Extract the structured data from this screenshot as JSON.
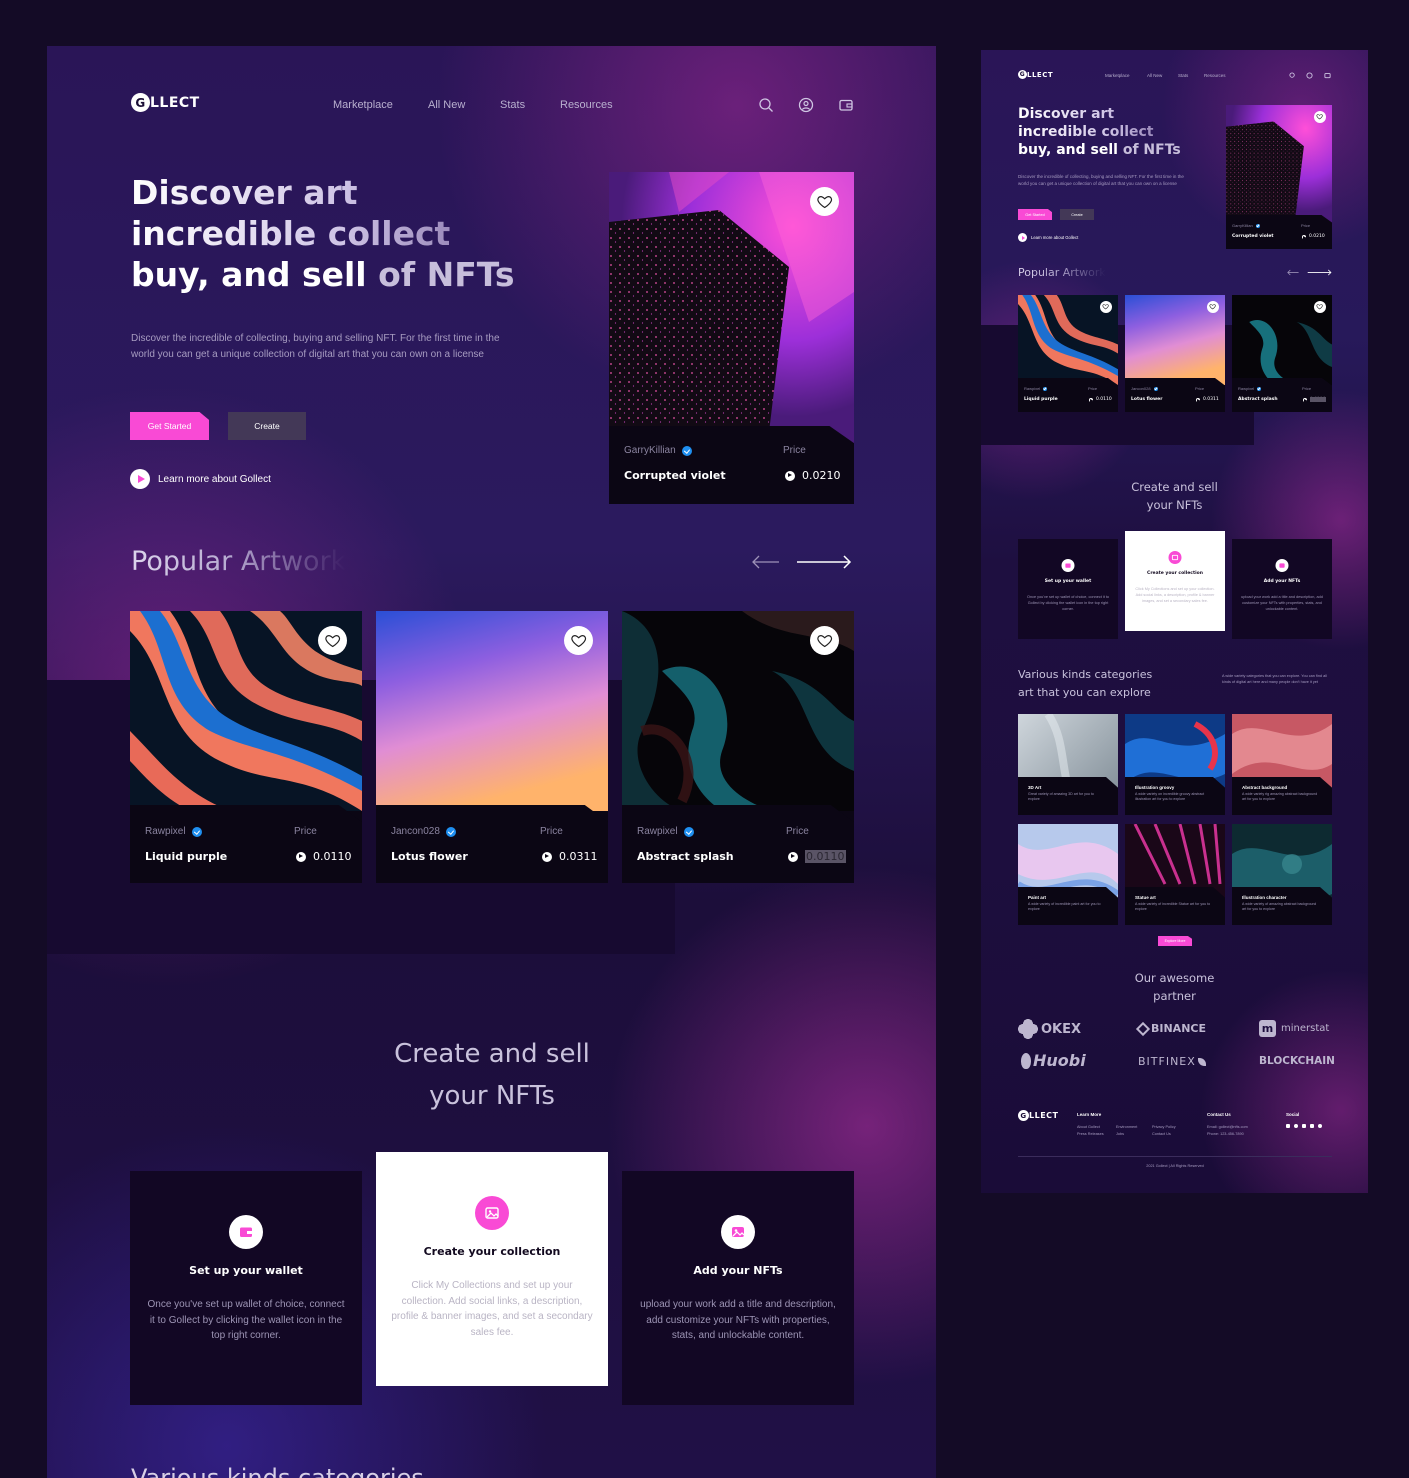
{
  "colors": {
    "accent": "#f94ad5",
    "verified": "#1f8ff0",
    "bg": "#2a1557",
    "card": "#0b0614"
  },
  "brand": {
    "logo_o": "G",
    "logo_rest": "LLECT"
  },
  "nav": {
    "items": [
      "Marketplace",
      "All New",
      "Stats",
      "Resources"
    ]
  },
  "header_icons": [
    "search-icon",
    "user-icon",
    "wallet-icon"
  ],
  "hero": {
    "title_line1": "Discover art",
    "title_line2": "incredible collect",
    "title_line3_a": "buy, and sell",
    "title_line3_b": "of NFTs",
    "description": "Discover the incredible of collecting, buying and selling NFT. For the first time in the world you can get a unique collection of digital art that you can own on a license",
    "cta_primary": "Get Started",
    "cta_secondary": "Create",
    "learn_more": "Learn more about Gollect"
  },
  "featured": {
    "creator": "GarryKillian",
    "title": "Corrupted violet",
    "price_label": "Price",
    "price": "0.0210"
  },
  "popular": {
    "title": "Popular Artwork",
    "items": [
      {
        "creator": "Rawpixel",
        "title": "Liquid purple",
        "price_label": "Price",
        "price": "0.0110"
      },
      {
        "creator": "Jancon028",
        "title": "Lotus flower",
        "price_label": "Price",
        "price": "0.0311"
      },
      {
        "creator": "Rawpixel",
        "title": "Abstract splash",
        "price_label": "Price",
        "price": "0.0110"
      }
    ]
  },
  "create": {
    "title_line1": "Create and sell",
    "title_line2": "your NFTs",
    "steps": [
      {
        "title": "Set up your wallet",
        "text": "Once you've set up wallet of choice, connect it to Gollect by clicking the wallet icon in the top right corner.",
        "icon": "wallet-icon"
      },
      {
        "title": "Create your collection",
        "text": "Click My Collections and set up your collection. Add social links, a description, profile & banner images, and set a secondary sales fee.",
        "icon": "image-icon"
      },
      {
        "title": "Add your NFTs",
        "text": "upload your work add a title and description, add customize your NFTs with properties, stats, and unlockable content.",
        "icon": "image-plus-icon"
      }
    ]
  },
  "small": {
    "categories_title_1": "Various kinds categories",
    "categories_title_2": "art that you can explore",
    "categories_desc": "A wide variety categories that you can explore. You can find all kinds of digital art here and many people don't have it yet",
    "categories": [
      {
        "title": "3D Art",
        "text": "Great variety of amazing 3D art for you to explore"
      },
      {
        "title": "Illustration groovy",
        "text": "A wide variety on incredible groovy abstract illustration art for you to explore"
      },
      {
        "title": "Abstract background",
        "text": "A wide variety rig amazing abstract background art for you to explore"
      },
      {
        "title": "Paint art",
        "text": "A wide variety of incredible paint art for you to explore"
      },
      {
        "title": "Statue art",
        "text": "A wide variety of incredible Statue art for you to explore"
      },
      {
        "title": "Illustration character",
        "text": "A wide variety of amazing abstract background art for you to explore"
      }
    ],
    "explore_btn": "Explore More",
    "partners_title_1": "Our awesome",
    "partners_title_2": "partner",
    "partners": [
      "OKEX",
      "BINANCE",
      "minerstat",
      "Huobi",
      "BITFINEX",
      "BLOCKCHAIN"
    ],
    "footer": {
      "learn_more": "Learn More",
      "links": [
        "About Gollect",
        "Environment",
        "Privacy Policy",
        "Press Releases",
        "Jobs",
        "Contact Us"
      ],
      "contact": "Contact Us",
      "email": "Email: gollect@nfts.com",
      "phone": "Phone: 123-456-7890",
      "social": "Social",
      "copyright": "2021 Gollect | All Rights Reserved"
    }
  }
}
